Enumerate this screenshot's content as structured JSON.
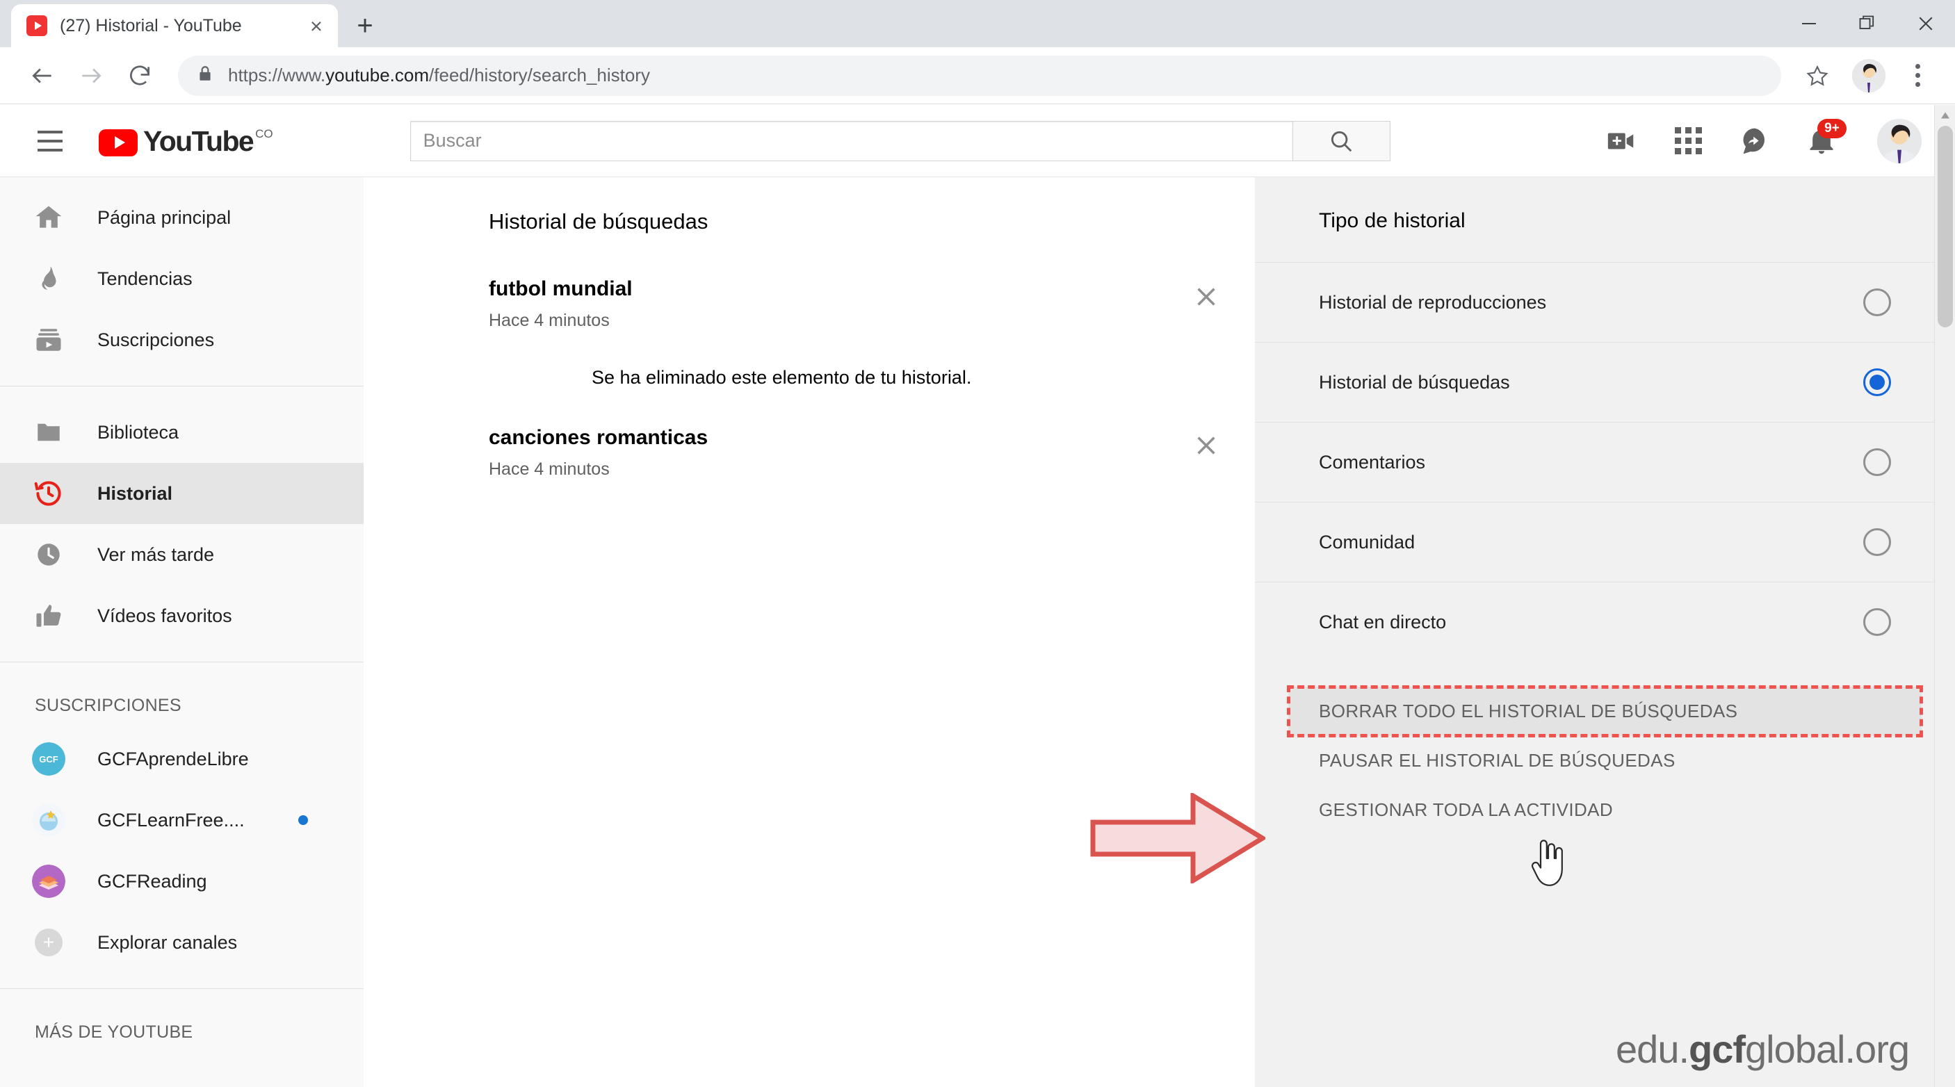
{
  "browser": {
    "tab": {
      "title": "(27) Historial - YouTube",
      "favicon": "youtube-favicon",
      "close": "×"
    },
    "new_tab_label": "+",
    "window_controls": {
      "minimize": "minimize-icon",
      "restore": "restore-icon",
      "close": "close-icon"
    },
    "nav": {
      "back": "back-arrow-icon",
      "forward": "forward-arrow-icon",
      "reload": "reload-icon"
    },
    "omnibox": {
      "lock": "lock-icon",
      "url_scheme": "https://www.",
      "url_host": "youtube.com",
      "url_path": "/feed/history/search_history"
    },
    "star": "star-icon",
    "profile": "chrome-profile-avatar",
    "menu": "three-dot-menu-icon"
  },
  "youtube": {
    "hamburger": "menu-icon",
    "logo": {
      "word": "YouTube",
      "country": "CO"
    },
    "search": {
      "placeholder": "Buscar",
      "value": "",
      "button_icon": "search-icon"
    },
    "header_actions": [
      {
        "name": "create-video-icon",
        "label": ""
      },
      {
        "name": "apps-grid-icon",
        "label": ""
      },
      {
        "name": "messages-icon",
        "label": ""
      },
      {
        "name": "notifications-bell-icon",
        "badge": "9+"
      }
    ],
    "account_avatar": "account-avatar"
  },
  "sidebar": {
    "primary": [
      {
        "label": "Página principal",
        "icon": "home-icon",
        "active": false
      },
      {
        "label": "Tendencias",
        "icon": "trending-flame-icon",
        "active": false
      },
      {
        "label": "Suscripciones",
        "icon": "subscriptions-icon",
        "active": false
      }
    ],
    "library": [
      {
        "label": "Biblioteca",
        "icon": "library-folder-icon",
        "active": false
      },
      {
        "label": "Historial",
        "icon": "history-clock-icon",
        "active": true
      },
      {
        "label": "Ver más tarde",
        "icon": "watch-later-clock-icon",
        "active": false
      },
      {
        "label": "Vídeos favoritos",
        "icon": "thumbs-up-icon",
        "active": false
      }
    ],
    "subscriptions_title": "SUSCRIPCIONES",
    "subscriptions": [
      {
        "label": "GCFAprendeLibre",
        "avatar_color": "#4bb8d8",
        "new": false
      },
      {
        "label": "GCFLearnFree....",
        "avatar_color": "#e9eef5",
        "new": true
      },
      {
        "label": "GCFReading",
        "avatar_color": "#b268c4",
        "new": false
      }
    ],
    "explore_label": "Explorar canales",
    "explore_icon": "plus-circle-icon",
    "more_title": "MÁS DE YOUTUBE"
  },
  "main": {
    "title": "Historial de búsquedas",
    "items": [
      {
        "query": "futbol mundial",
        "time": "Hace 4 minutos",
        "remove_icon": "close-icon"
      },
      {
        "query": "canciones romanticas",
        "time": "Hace 4 minutos",
        "remove_icon": "close-icon"
      }
    ],
    "removed_notice": "Se ha eliminado este elemento de tu historial."
  },
  "right_panel": {
    "title": "Tipo de historial",
    "options": [
      {
        "label": "Historial de reproducciones",
        "selected": false
      },
      {
        "label": "Historial de búsquedas",
        "selected": true
      },
      {
        "label": "Comentarios",
        "selected": false
      },
      {
        "label": "Comunidad",
        "selected": false
      },
      {
        "label": "Chat en directo",
        "selected": false
      }
    ],
    "actions": [
      {
        "label": "BORRAR TODO EL HISTORIAL DE BÚSQUEDAS",
        "highlighted": true
      },
      {
        "label": "PAUSAR EL HISTORIAL DE BÚSQUEDAS",
        "highlighted": false
      },
      {
        "label": "GESTIONAR TODA LA ACTIVIDAD",
        "highlighted": false
      }
    ]
  },
  "annotations": {
    "arrow": "red-arrow-pointing-right",
    "arrow_fill": "#f6dcdc",
    "arrow_stroke": "#d9534f",
    "highlight_border": "#ef5350",
    "cursor": "hand-pointer-cursor"
  },
  "watermark": {
    "prefix": "edu.",
    "brand": "gcf",
    "suffix": "global.org"
  }
}
